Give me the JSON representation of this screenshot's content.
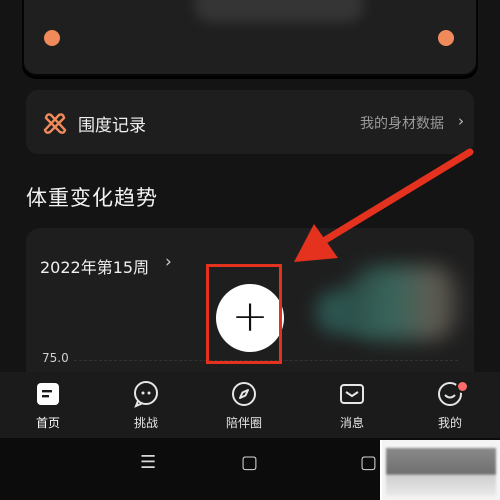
{
  "girth_record": {
    "label": "围度记录",
    "link": "我的身材数据",
    "chevron": "›"
  },
  "weight_trend": {
    "section_title": "体重变化趋势",
    "week_label": "2022年第15周",
    "week_chevron": "›",
    "y_tick": "75.0",
    "add_button": "+"
  },
  "tabs": [
    {
      "label": "首页",
      "icon": "home-icon",
      "active": true
    },
    {
      "label": "挑战",
      "icon": "chat-bubble-icon"
    },
    {
      "label": "陪伴圈",
      "icon": "compass-icon"
    },
    {
      "label": "消息",
      "icon": "inbox-icon"
    },
    {
      "label": "我的",
      "icon": "smiley-icon"
    }
  ],
  "nav": {
    "menu": "☰",
    "home": "▢",
    "back": "▢"
  },
  "colors": {
    "accent_dot": "#f08a5a",
    "highlight_red": "#e4321f",
    "notification_dot": "#ff6b6b"
  }
}
